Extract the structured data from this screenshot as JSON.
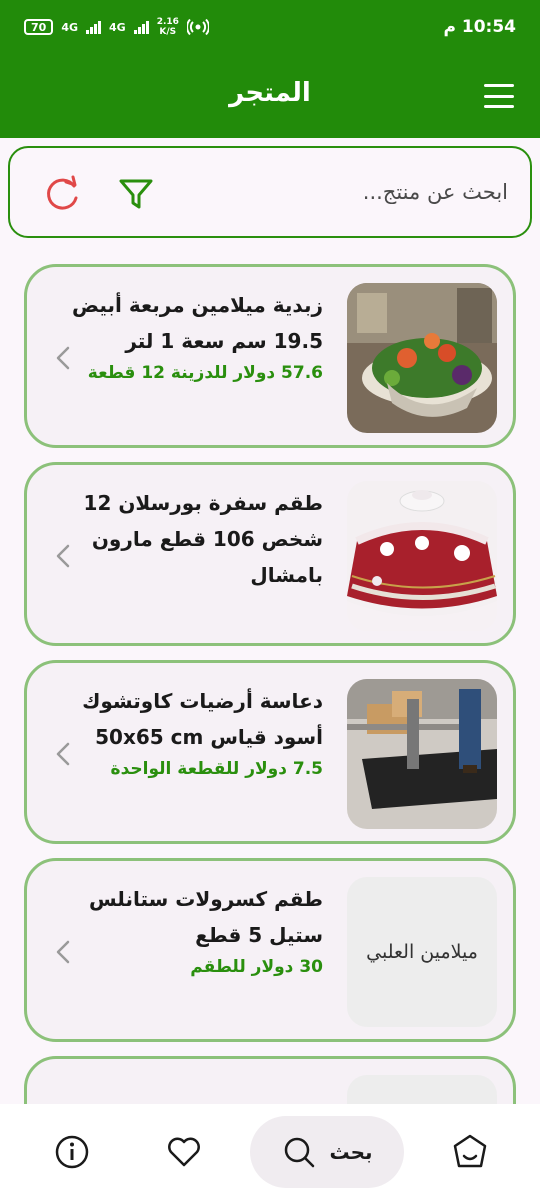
{
  "status_bar": {
    "time": "10:54 م",
    "battery": "70",
    "net1": "4G",
    "net2": "4G",
    "speed": "2.16",
    "speed_unit": "K/S"
  },
  "app_bar": {
    "title": "المتجر"
  },
  "search": {
    "placeholder": "ابحث عن منتج..."
  },
  "products": [
    {
      "name": "زبدية ميلامين مربعة أبيض 19.5 سم سعة 1 لتر",
      "price": "57.6 دولار للدزينة 12 قطعة"
    },
    {
      "name": "طقم سفرة بورسلان 12 شخص 106 قطع مارون بامشال",
      "price": ""
    },
    {
      "name": "دعاسة أرضيات كاوتشوك أسود قياس 50x65 cm",
      "price": "7.5 دولار للقطعة الواحدة"
    },
    {
      "name": "طقم كسرولات ستانلس ستيل 5 قطع",
      "price": "30 دولار للطقم",
      "image_text": "ميلامين العلبي"
    }
  ],
  "bottom_nav": {
    "search_label": "بحث"
  },
  "colors": {
    "primary": "#228b0a",
    "card_border": "#8cc17a",
    "price": "#2a8f0e"
  }
}
